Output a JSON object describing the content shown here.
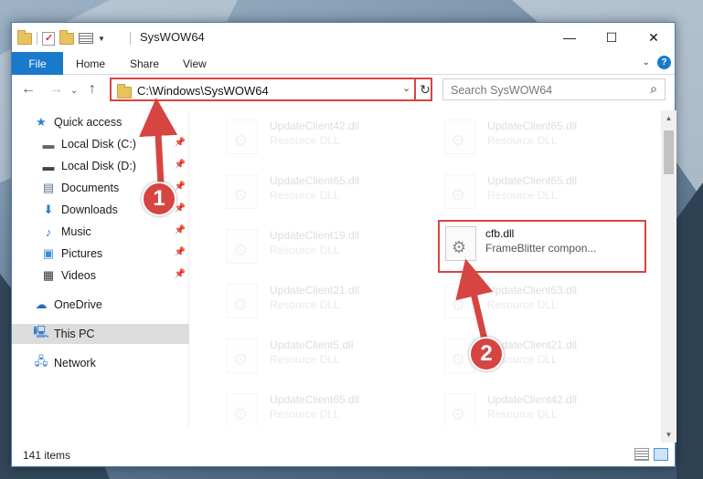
{
  "window": {
    "title": "SysWOW64",
    "buttons": {
      "minimize": "—",
      "maximize": "☐",
      "close": "✕"
    }
  },
  "ribbon": {
    "file": "File",
    "home": "Home",
    "share": "Share",
    "view": "View",
    "help": "?"
  },
  "nav": {
    "address": "C:\\Windows\\SysWOW64",
    "search_placeholder": "Search SysWOW64"
  },
  "sidebar": {
    "items": [
      {
        "label": "Quick access",
        "icon": "star-icon"
      },
      {
        "label": "Local Disk (C:)",
        "icon": "drive-icon"
      },
      {
        "label": "Local Disk (D:)",
        "icon": "drive-icon"
      },
      {
        "label": "Documents",
        "icon": "documents-icon"
      },
      {
        "label": "Downloads",
        "icon": "download-icon"
      },
      {
        "label": "Music",
        "icon": "music-icon"
      },
      {
        "label": "Pictures",
        "icon": "pictures-icon"
      },
      {
        "label": "Videos",
        "icon": "videos-icon"
      },
      {
        "label": "OneDrive",
        "icon": "cloud-icon"
      },
      {
        "label": "This PC",
        "icon": "computer-icon"
      },
      {
        "label": "Network",
        "icon": "network-icon"
      }
    ]
  },
  "files": [
    {
      "name": "UpdateClient42.dll",
      "type": "Resource DLL"
    },
    {
      "name": "UpdateClient65.dll",
      "type": "Resource DLL"
    },
    {
      "name": "UpdateClient65.dll",
      "type": "Resource DLL"
    },
    {
      "name": "UpdateClient65.dll",
      "type": "Resource DLL"
    },
    {
      "name": "UpdateClient19.dll",
      "type": "Resource DLL"
    },
    {
      "name": "cfb.dll",
      "type": "FrameBlitter compon..."
    },
    {
      "name": "UpdateClient21.dll",
      "type": "Resource DLL"
    },
    {
      "name": "UpdateClient63.dll",
      "type": "Resource DLL"
    },
    {
      "name": "UpdateClient5.dll",
      "type": "Resource DLL"
    },
    {
      "name": "UpdateClient21.dll",
      "type": "Resource DLL"
    },
    {
      "name": "UpdateClient65.dll",
      "type": "Resource DLL"
    },
    {
      "name": "UpdateClient42.dll",
      "type": "Resource DLL"
    }
  ],
  "status": {
    "count": "141 items"
  },
  "annotations": {
    "step1": "1",
    "step2": "2"
  },
  "colors": {
    "accent": "#1979ca",
    "highlight": "#d64541"
  }
}
